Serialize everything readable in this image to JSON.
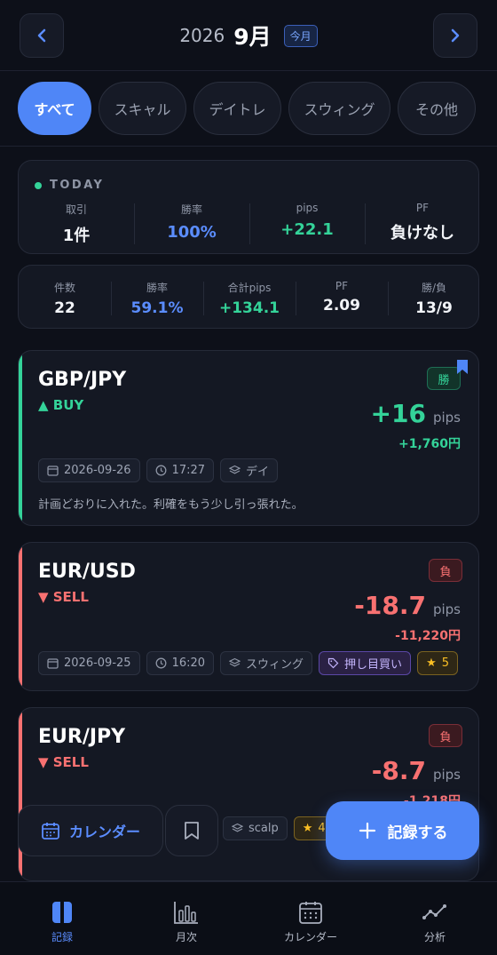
{
  "header": {
    "year": "2026",
    "month": "9月",
    "today_chip": "今月"
  },
  "filters": [
    {
      "label": "すべて",
      "active": true
    },
    {
      "label": "スキャル",
      "active": false
    },
    {
      "label": "デイトレ",
      "active": false
    },
    {
      "label": "スウィング",
      "active": false
    },
    {
      "label": "その他",
      "active": false
    }
  ],
  "today": {
    "label": "TODAY",
    "stats": [
      {
        "label": "取引",
        "value": "1件"
      },
      {
        "label": "勝率",
        "value": "100%"
      },
      {
        "label": "pips",
        "value": "+22.1"
      },
      {
        "label": "PF",
        "value": "負けなし"
      }
    ]
  },
  "summary": {
    "stats": [
      {
        "label": "件数",
        "value": "22"
      },
      {
        "label": "勝率",
        "value": "59.1%"
      },
      {
        "label": "合計pips",
        "value": "+134.1"
      },
      {
        "label": "PF",
        "value": "2.09"
      },
      {
        "label": "勝/負",
        "value": "13/9"
      }
    ]
  },
  "trades": [
    {
      "pair": "GBP/JPY",
      "direction": "▲ BUY",
      "result": "勝",
      "pips": "+16",
      "pips_unit": "pips",
      "yen": "+1,760円",
      "date": "2026-09-26",
      "time": "17:27",
      "style": "デイ",
      "note": "計画どおりに入れた。利確をもう少し引っ張れた。",
      "bookmarked": true
    },
    {
      "pair": "EUR/USD",
      "direction": "▼ SELL",
      "result": "負",
      "pips": "-18.7",
      "pips_unit": "pips",
      "yen": "-11,220円",
      "date": "2026-09-25",
      "time": "16:20",
      "style": "スウィング",
      "setup": "押し目買い",
      "rating": "5"
    },
    {
      "pair": "EUR/JPY",
      "direction": "▼ SELL",
      "result": "負",
      "pips": "-8.7",
      "pips_unit": "pips",
      "yen": "-1,218円",
      "style": "scalp",
      "rating": "4"
    }
  ],
  "actions": {
    "calendar": "カレンダー",
    "add": "記録する"
  },
  "tabs": [
    {
      "label": "記録",
      "active": true
    },
    {
      "label": "月次",
      "active": false
    },
    {
      "label": "カレンダー",
      "active": false
    },
    {
      "label": "分析",
      "active": false
    }
  ],
  "colors": {
    "accent": "#4f86f7",
    "win": "#34d399",
    "loss": "#f87171",
    "background": "#0d1019"
  }
}
